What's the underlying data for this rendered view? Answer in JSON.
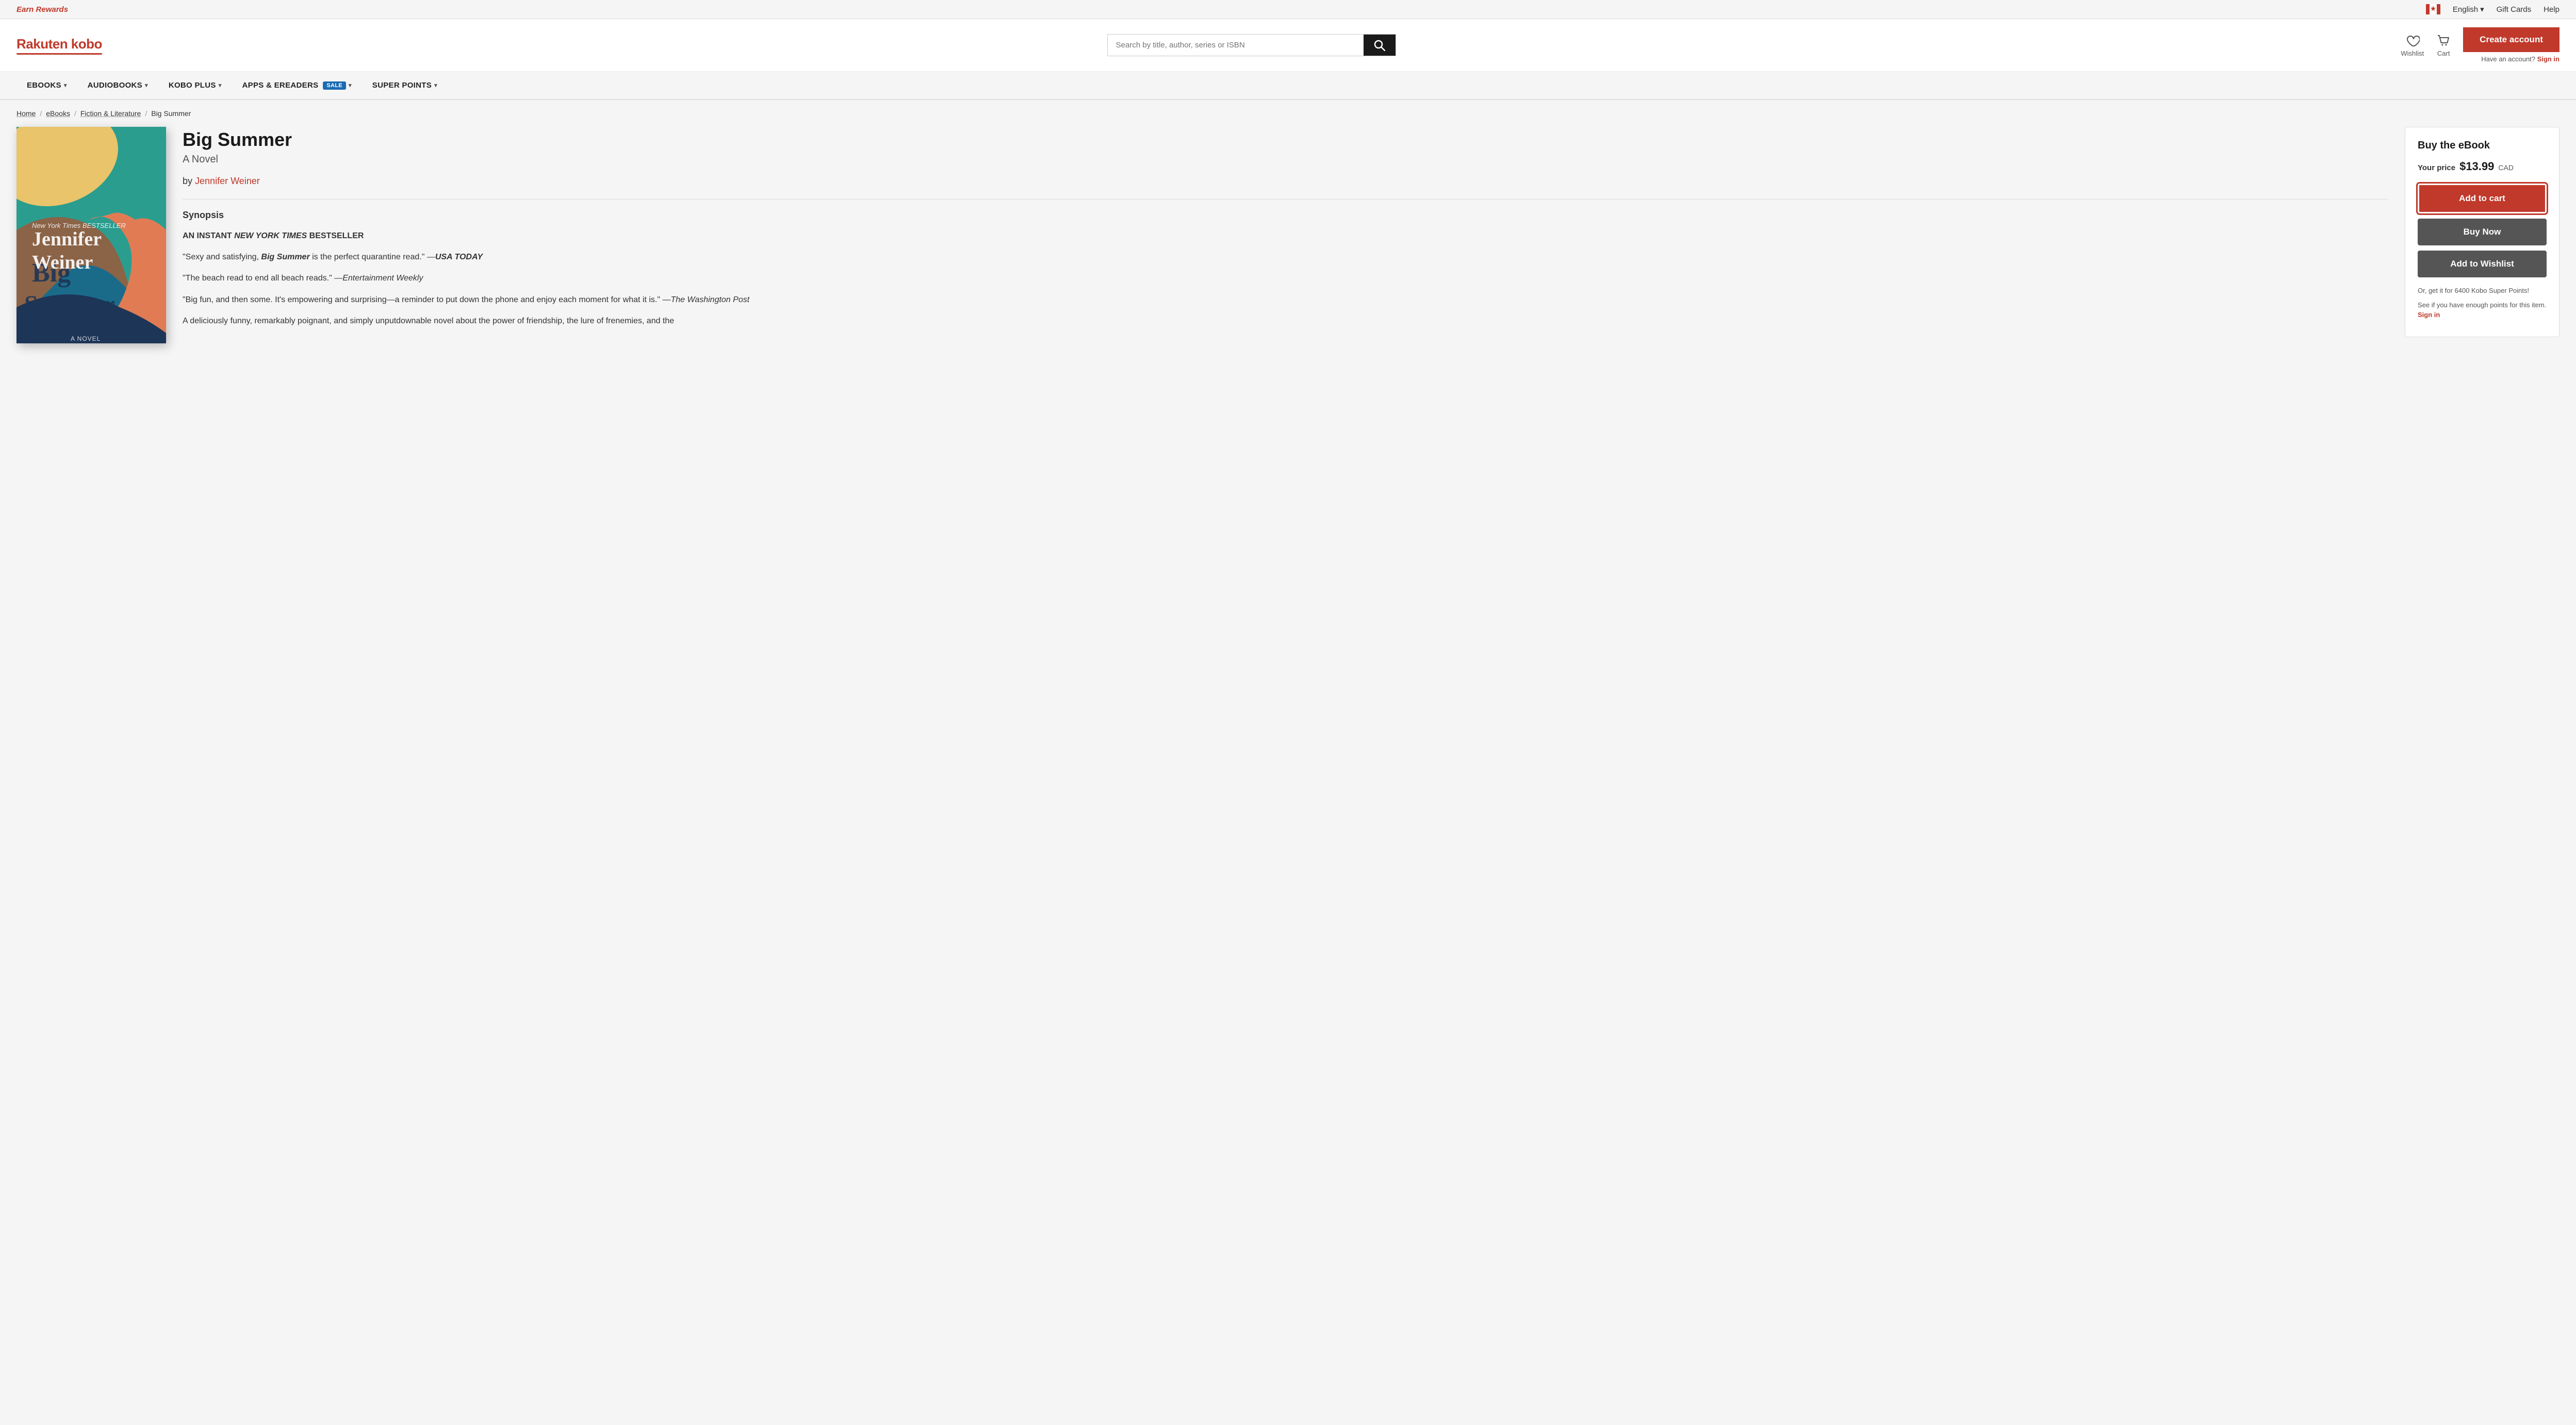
{
  "topbar": {
    "earn_rewards": "Earn Rewards",
    "language": "English",
    "language_chevron": "▾",
    "gift_cards": "Gift Cards",
    "help": "Help"
  },
  "header": {
    "logo_text": "Rakuten kobo",
    "search_placeholder": "Search by title, author, series or ISBN",
    "wishlist_label": "Wishlist",
    "cart_label": "Cart",
    "create_account": "Create account",
    "have_account": "Have an account?",
    "sign_in": "Sign in"
  },
  "nav": {
    "items": [
      {
        "label": "eBOOKS",
        "chevron": "▾",
        "sale": false
      },
      {
        "label": "AUDIOBOOKS",
        "chevron": "▾",
        "sale": false
      },
      {
        "label": "KOBO PLUS",
        "chevron": "▾",
        "sale": false
      },
      {
        "label": "APPS & eREADERS",
        "chevron": "▾",
        "sale": true
      },
      {
        "label": "SUPER POINTS",
        "chevron": "▾",
        "sale": false
      }
    ],
    "sale_badge": "SALE"
  },
  "breadcrumb": {
    "home": "Home",
    "ebooks": "eBooks",
    "category": "Fiction & Literature",
    "current": "Big Summer"
  },
  "book": {
    "title": "Big Summer",
    "subtitle": "A Novel",
    "author_prefix": "by",
    "author": "Jennifer Weiner",
    "synopsis_label": "Synopsis",
    "synopsis_lines": [
      "AN INSTANT NEW YORK TIMES BESTSELLER",
      "\"Sexy and satisfying, Big Summer is the perfect quarantine read.\" —USA TODAY",
      "\"The beach read to end all beach reads.\" —Entertainment Weekly",
      "\"Big fun, and then some. It's empowering and surprising—a reminder to put down the phone and enjoy each moment for what it is.\" —The Washington Post",
      "A deliciously funny, remarkably poignant, and simply unputdownable novel about the power of friendship, the lure of frenemies, and the"
    ]
  },
  "buy_panel": {
    "title": "Buy the eBook",
    "price_label": "Your price",
    "price": "$13.99",
    "currency": "CAD",
    "add_to_cart": "Add to cart",
    "buy_now": "Buy Now",
    "add_to_wishlist": "Add to Wishlist",
    "kobo_points_text": "Or, get it for 6400 Kobo Super Points!",
    "sign_in_prompt": "See if you have enough points for this item.",
    "sign_in": "Sign in"
  },
  "colors": {
    "brand_red": "#c0392b",
    "dark_bg": "#1a1a1a",
    "mid_gray": "#555",
    "light_bg": "#f5f5f5"
  }
}
